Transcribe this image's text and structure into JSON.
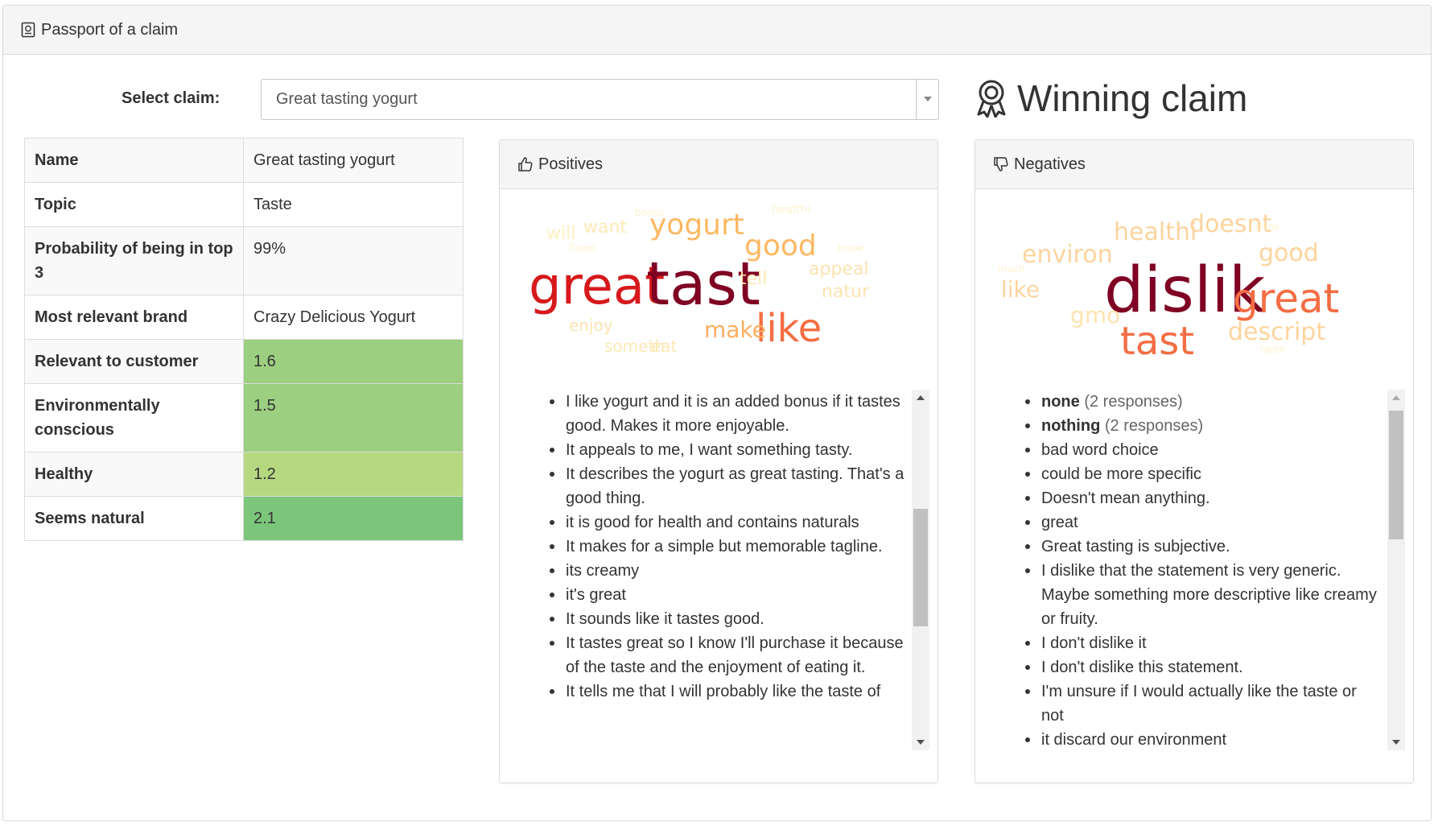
{
  "header": {
    "title": "Passport of a claim"
  },
  "select": {
    "label": "Select claim:",
    "value": "Great tasting yogurt"
  },
  "winning": {
    "text": "Winning claim"
  },
  "info": {
    "rows": [
      {
        "key": "Name",
        "value": "Great tasting yogurt"
      },
      {
        "key": "Topic",
        "value": "Taste"
      },
      {
        "key": "Probability of being in top 3",
        "value": "99%"
      },
      {
        "key": "Most relevant brand",
        "value": "Crazy Delicious Yogurt"
      },
      {
        "key": "Relevant to customer",
        "value": "1.6",
        "color": "#9ccf7f"
      },
      {
        "key": "Environmentally conscious",
        "value": "1.5",
        "color": "#9ccf7f"
      },
      {
        "key": "Healthy",
        "value": "1.2",
        "color": "#b5d881"
      },
      {
        "key": "Seems natural",
        "value": "2.1",
        "color": "#7bc67b"
      }
    ]
  },
  "positives": {
    "title": "Positives",
    "cloud": [
      {
        "text": "great",
        "color": "#d7191c"
      },
      {
        "text": "tast",
        "color": "#7f0022"
      },
      {
        "text": "like",
        "color": "#f46d43"
      },
      {
        "text": "yogurt",
        "color": "#fdb863"
      },
      {
        "text": "good",
        "color": "#fdb863"
      },
      {
        "text": "make",
        "color": "#fdae61"
      },
      {
        "text": "want",
        "color": "#fde9b5"
      },
      {
        "text": "will",
        "color": "#fdf0c2"
      },
      {
        "text": "appeal",
        "color": "#fde3b0"
      },
      {
        "text": "natur",
        "color": "#fde3b0"
      },
      {
        "text": "tell",
        "color": "#fde9b5"
      },
      {
        "text": "enjoy",
        "color": "#fde3b0"
      },
      {
        "text": "someth",
        "color": "#fde9b5"
      },
      {
        "text": "eat",
        "color": "#fde9b5"
      },
      {
        "text": "healthi",
        "color": "#fef3d0"
      },
      {
        "text": "bonus",
        "color": "#fef3d0"
      },
      {
        "text": "flavor",
        "color": "#fef3d0"
      },
      {
        "text": "know",
        "color": "#fef3d0"
      }
    ],
    "items": [
      {
        "text": "I like yogurt and it is an added bonus if it tastes good. Makes it more enjoyable."
      },
      {
        "text": "It appeals to me, I want something tasty."
      },
      {
        "text": "It describes the yogurt as great tasting. That's a good thing."
      },
      {
        "text": "it is good for health and contains naturals"
      },
      {
        "text": "It makes for a simple but memorable tagline."
      },
      {
        "text": "its creamy"
      },
      {
        "text": "it's great"
      },
      {
        "text": "It sounds like it tastes good."
      },
      {
        "text": "It tastes great so I know I'll purchase it because of the taste and the enjoyment of eating it."
      },
      {
        "text": "It tells me that I will probably like the taste of"
      }
    ]
  },
  "negatives": {
    "title": "Negatives",
    "cloud": [
      {
        "text": "dislik",
        "color": "#7f0022"
      },
      {
        "text": "great",
        "color": "#f46d43"
      },
      {
        "text": "tast",
        "color": "#f46d43"
      },
      {
        "text": "healthi",
        "color": "#fdd49e"
      },
      {
        "text": "doesnt",
        "color": "#fdd49e"
      },
      {
        "text": "environ",
        "color": "#fdd49e"
      },
      {
        "text": "good",
        "color": "#fdd49e"
      },
      {
        "text": "like",
        "color": "#fdd49e"
      },
      {
        "text": "gmo",
        "color": "#fde3b0"
      },
      {
        "text": "descript",
        "color": "#fdd49e"
      },
      {
        "text": "think",
        "color": "#fef3d0"
      },
      {
        "text": "much",
        "color": "#fef3d0"
      },
      {
        "text": "taste",
        "color": "#fef3d0"
      }
    ],
    "items": [
      {
        "bold": "none",
        "suffix": " (2 responses)"
      },
      {
        "bold": "nothing",
        "suffix": " (2 responses)"
      },
      {
        "text": "bad word choice"
      },
      {
        "text": "could be more specific"
      },
      {
        "text": "Doesn't mean anything."
      },
      {
        "text": "great"
      },
      {
        "text": "Great tasting is subjective."
      },
      {
        "text": "I dislike that the statement is very generic. Maybe something more descriptive like creamy or fruity."
      },
      {
        "text": "I don't dislike it"
      },
      {
        "text": "I don't dislike this statement."
      },
      {
        "text": "I'm unsure if I would actually like the taste or not"
      },
      {
        "text": "it discard our environment"
      }
    ]
  }
}
